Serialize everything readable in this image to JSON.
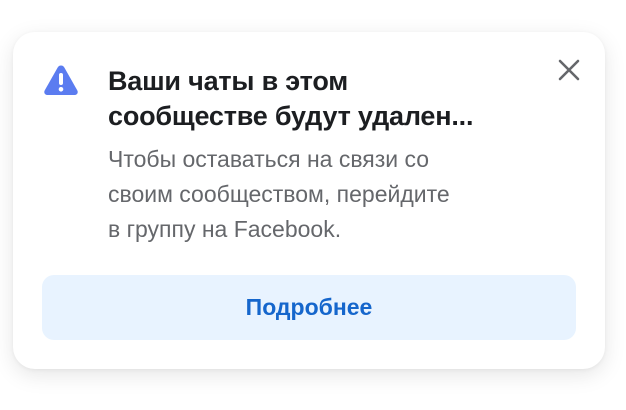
{
  "dialog": {
    "icon": "warning-triangle-icon",
    "title_lines": [
      "Ваши чаты в этом",
      "сообществе будут удален..."
    ],
    "description_lines": [
      "Чтобы оставаться на связи со",
      "своим сообществом, перейдите",
      "в группу на Facebook."
    ],
    "close_icon": "close-icon",
    "action_label": "Подробнее"
  },
  "colors": {
    "warning_icon": "#5b7cf0",
    "title": "#1c1e21",
    "description": "#65676b",
    "button_bg": "#e8f3ff",
    "button_text": "#1566cc",
    "close_icon": "#65676b"
  }
}
